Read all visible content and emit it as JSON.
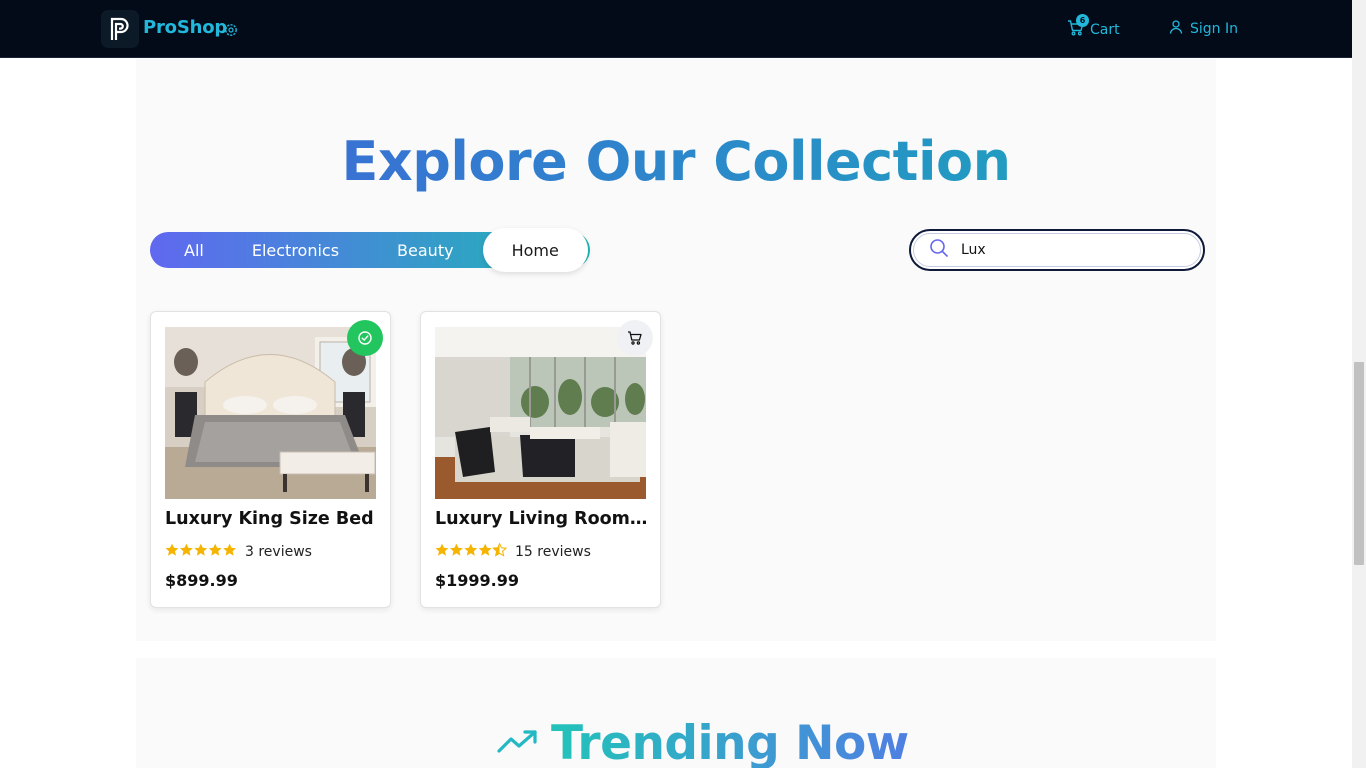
{
  "header": {
    "brand": "ProShop",
    "cart_label": "Cart",
    "cart_count": "6",
    "signin_label": "Sign In"
  },
  "collection": {
    "heading": "Explore Our Collection",
    "tabs": [
      {
        "label": "All",
        "active": false
      },
      {
        "label": "Electronics",
        "active": false
      },
      {
        "label": "Beauty",
        "active": false
      },
      {
        "label": "Home",
        "active": true
      }
    ],
    "search": {
      "value": "Lux",
      "placeholder": ""
    }
  },
  "products": [
    {
      "title": "Luxury King Size Bed",
      "rating": 5,
      "reviews": "3 reviews",
      "price": "$899.99",
      "in_cart": true
    },
    {
      "title": "Luxury Living Room Collection",
      "rating": 4.5,
      "reviews": "15 reviews",
      "price": "$1999.99",
      "in_cart": false
    }
  ],
  "trending": {
    "heading": "Trending Now"
  },
  "colors": {
    "header_bg": "#030a18",
    "accent": "#22b8dc",
    "star": "#f5b400",
    "in_cart_badge": "#22c55e"
  }
}
